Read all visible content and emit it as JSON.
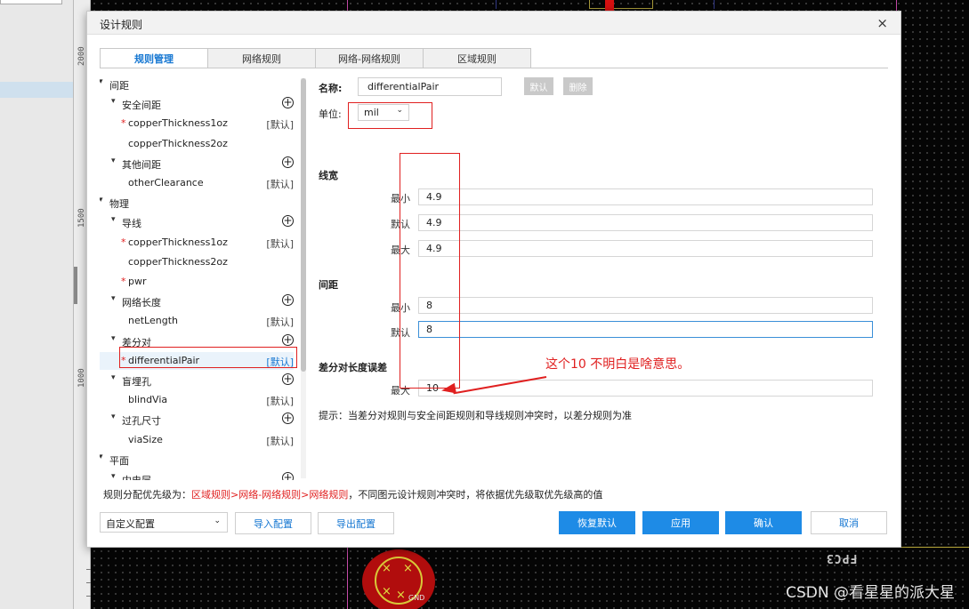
{
  "background": {
    "ruler_ticks": [
      "2000",
      "1500",
      "1000"
    ],
    "pcb_label": "FPC3",
    "pad_label": "GND",
    "watermark": "CSDN @看星星的派大星"
  },
  "dialog": {
    "title": "设计规则",
    "close_glyph": "×",
    "tabs": [
      "规则管理",
      "网络规则",
      "网络-网络规则",
      "区域规则"
    ],
    "active_tab": 0,
    "tree": [
      {
        "label": "间距",
        "caret": true,
        "level": 0
      },
      {
        "label": "安全间距",
        "caret": true,
        "level": 1,
        "plus": true
      },
      {
        "label": "copperThickness1oz",
        "level": 2,
        "star": true,
        "default": "[默认]"
      },
      {
        "label": "copperThickness2oz",
        "level": 2
      },
      {
        "label": "其他间距",
        "caret": true,
        "level": 1,
        "plus": true
      },
      {
        "label": "otherClearance",
        "level": 2,
        "default": "[默认]"
      },
      {
        "label": "物理",
        "caret": true,
        "level": 0
      },
      {
        "label": "导线",
        "caret": true,
        "level": 1,
        "plus": true
      },
      {
        "label": "copperThickness1oz",
        "level": 2,
        "star": true,
        "default": "[默认]"
      },
      {
        "label": "copperThickness2oz",
        "level": 2
      },
      {
        "label": "pwr",
        "level": 2,
        "star": true
      },
      {
        "label": "网络长度",
        "caret": true,
        "level": 1,
        "plus": true
      },
      {
        "label": "netLength",
        "level": 2,
        "default": "[默认]"
      },
      {
        "label": "差分对",
        "caret": true,
        "level": 1,
        "plus": true
      },
      {
        "label": "differentialPair",
        "level": 2,
        "star": true,
        "default": "[默认]",
        "selected": true
      },
      {
        "label": "盲埋孔",
        "caret": true,
        "level": 1,
        "plus": true
      },
      {
        "label": "blindVia",
        "level": 2,
        "default": "[默认]"
      },
      {
        "label": "过孔尺寸",
        "caret": true,
        "level": 1,
        "plus": true
      },
      {
        "label": "viaSize",
        "level": 2,
        "default": "[默认]"
      },
      {
        "label": "平面",
        "caret": true,
        "level": 0
      },
      {
        "label": "内电层",
        "caret": true,
        "level": 1,
        "plus": true
      }
    ],
    "form": {
      "name_label": "名称:",
      "name_value": "differentialPair",
      "default_button": "默认",
      "delete_button": "删除",
      "unit_label": "单位:",
      "unit_value": "mil",
      "sections": {
        "width": {
          "title": "线宽",
          "rows": [
            {
              "label": "最小",
              "value": "4.9"
            },
            {
              "label": "默认",
              "value": "4.9"
            },
            {
              "label": "最大",
              "value": "4.9"
            }
          ]
        },
        "spacing": {
          "title": "间距",
          "rows": [
            {
              "label": "最小",
              "value": "8"
            },
            {
              "label": "默认",
              "value": "8"
            }
          ]
        },
        "length_error": {
          "title": "差分对长度误差",
          "rows": [
            {
              "label": "最大",
              "value": "10"
            }
          ]
        }
      },
      "annotation": "这个10 不明白是啥意思。",
      "hint": "提示：当差分对规则与安全间距规则和导线规则冲突时，以差分规则为准"
    },
    "priority": {
      "prefix": "规则分配优先级为：",
      "order": "区域规则>网络-网络规则>网络规则",
      "suffix": "，不同图元设计规则冲突时，将依据优先级取优先级高的值"
    },
    "footer": {
      "config_value": "自定义配置",
      "import_button": "导入配置",
      "export_button": "导出配置",
      "restore_button": "恢复默认",
      "apply_button": "应用",
      "ok_button": "确认",
      "cancel_button": "取消"
    }
  }
}
